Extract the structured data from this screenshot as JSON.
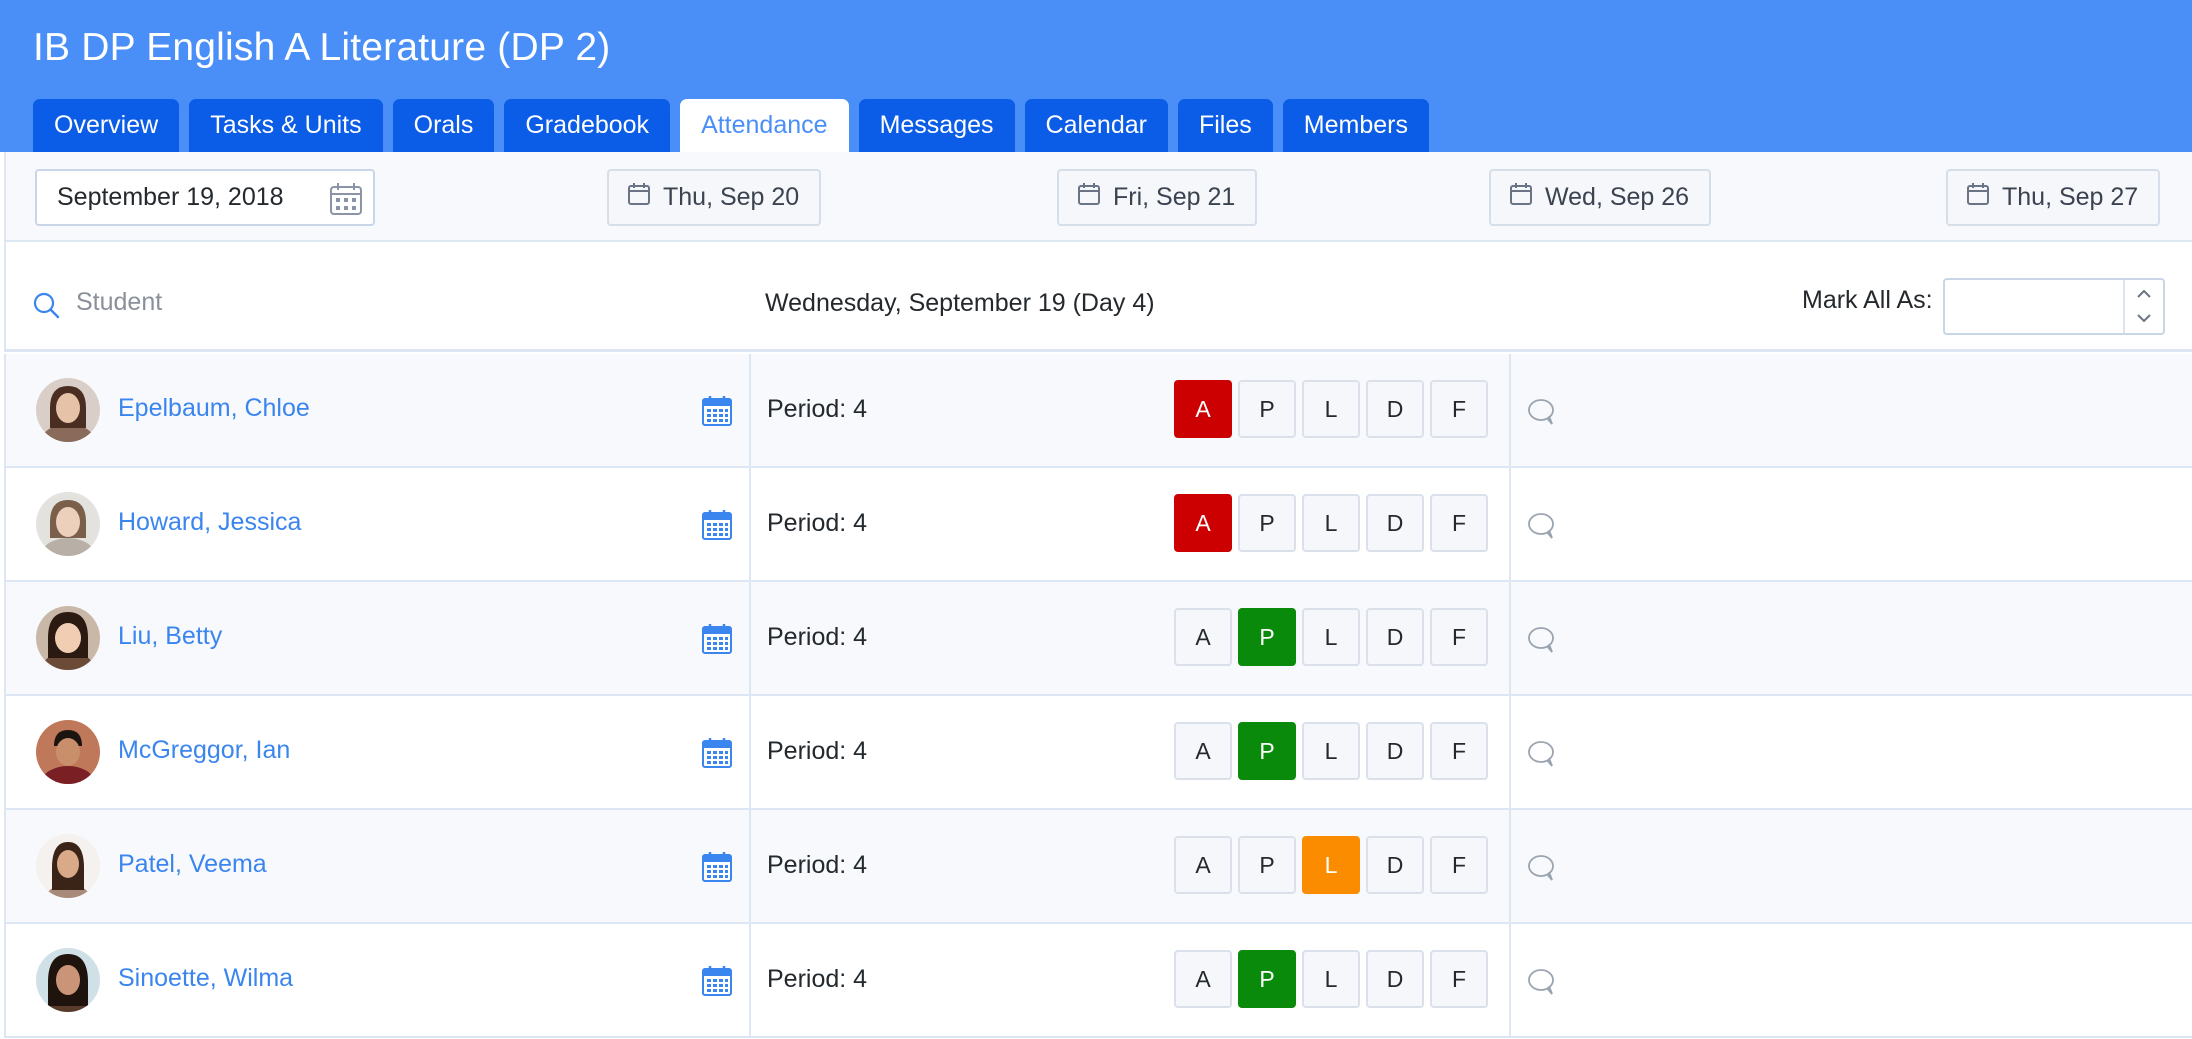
{
  "course": {
    "title": "IB DP English A Literature (DP 2)"
  },
  "tabs": [
    {
      "label": "Overview",
      "active": false
    },
    {
      "label": "Tasks & Units",
      "active": false
    },
    {
      "label": "Orals",
      "active": false
    },
    {
      "label": "Gradebook",
      "active": false
    },
    {
      "label": "Attendance",
      "active": true
    },
    {
      "label": "Messages",
      "active": false
    },
    {
      "label": "Calendar",
      "active": false
    },
    {
      "label": "Files",
      "active": false
    },
    {
      "label": "Members",
      "active": false
    }
  ],
  "date_picker": {
    "value": "September 19, 2018",
    "icon": "calendar-grid-icon"
  },
  "date_shortcuts": [
    {
      "label": "Thu, Sep 20",
      "icon": "calendar-icon"
    },
    {
      "label": "Fri, Sep 21",
      "icon": "calendar-icon"
    },
    {
      "label": "Wed, Sep 26",
      "icon": "calendar-icon"
    },
    {
      "label": "Thu, Sep 27",
      "icon": "calendar-icon"
    }
  ],
  "search": {
    "placeholder": "Student",
    "value": "",
    "icon": "search-icon"
  },
  "day_label": "Wednesday, September 19 (Day 4)",
  "mark_all": {
    "label": "Mark All As:",
    "value": ""
  },
  "attendance_codes": [
    "A",
    "P",
    "L",
    "D",
    "F"
  ],
  "students": [
    {
      "name": "Epelbaum, Chloe",
      "period": "Period: 4",
      "status": "A"
    },
    {
      "name": "Howard, Jessica",
      "period": "Period: 4",
      "status": "A"
    },
    {
      "name": "Liu, Betty",
      "period": "Period: 4",
      "status": "P"
    },
    {
      "name": "McGreggor, Ian",
      "period": "Period: 4",
      "status": "P"
    },
    {
      "name": "Patel, Veema",
      "period": "Period: 4",
      "status": "L"
    },
    {
      "name": "Sinoette, Wilma",
      "period": "Period: 4",
      "status": "P"
    }
  ],
  "colors": {
    "header_bg": "#4a8ff7",
    "tab_bg": "#0b5ce6",
    "link": "#3b85ef",
    "absent": "#cc0000",
    "present": "#0a8a0a",
    "late": "#fb8c00"
  }
}
